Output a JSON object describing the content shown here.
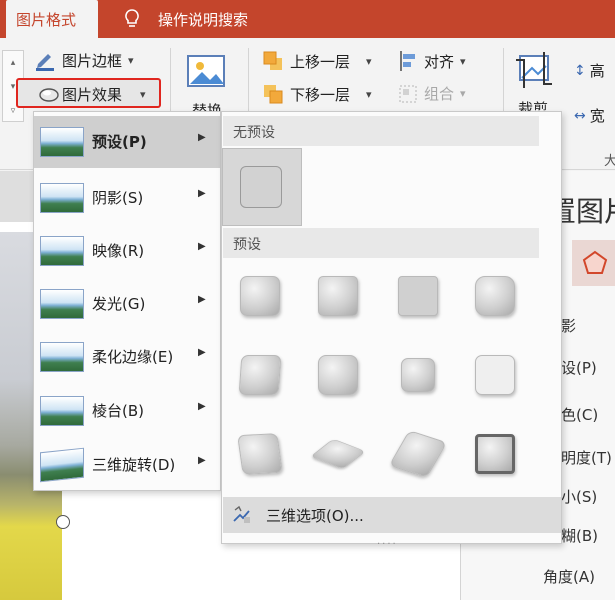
{
  "tabs": {
    "active": "图片格式",
    "tell_me": "操作说明搜索"
  },
  "ribbon": {
    "border_label": "图片边框",
    "effects_label": "图片效果",
    "replace_label": "替换",
    "bring_forward": "上移一层",
    "send_backward": "下移一层",
    "align": "对齐",
    "group": "组合",
    "crop": "裁剪",
    "height_label": "高",
    "width_label": "宽",
    "size_caption": "大"
  },
  "effects_menu": [
    {
      "label": "预设(P)",
      "active": true
    },
    {
      "label": "阴影(S)"
    },
    {
      "label": "映像(R)"
    },
    {
      "label": "发光(G)"
    },
    {
      "label": "柔化边缘(E)"
    },
    {
      "label": "棱台(B)"
    },
    {
      "label": "三维旋转(D)"
    }
  ],
  "gallery": {
    "no_preset_header": "无预设",
    "preset_header": "预设",
    "footer_label": "三维选项(O)...",
    "grip": "....",
    "preset_count": 12
  },
  "format_pane": {
    "title": "置图片",
    "items": [
      "影",
      "设(P)",
      "色(C)",
      "明度(T)",
      "小(S)",
      "糊(B)",
      "角度(A)"
    ]
  },
  "colors": {
    "accent": "#c4452c",
    "highlight_box": "#e0261f"
  }
}
